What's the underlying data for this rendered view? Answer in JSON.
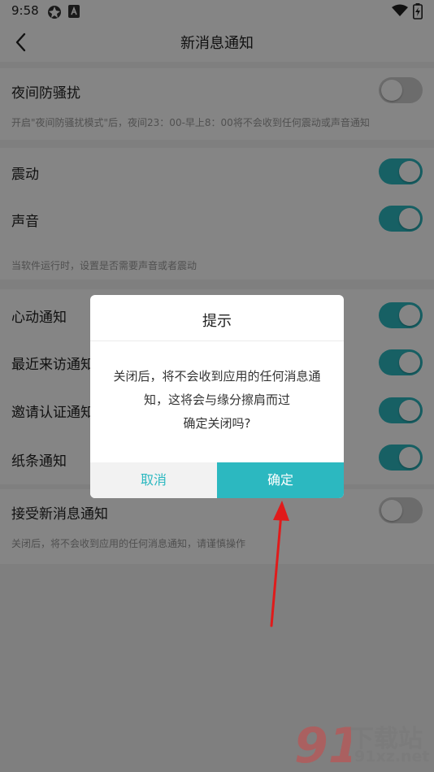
{
  "status_bar": {
    "time": "9:58",
    "icons": [
      "ball-icon",
      "app-a-icon",
      "wifi-icon",
      "battery-charging-icon"
    ]
  },
  "header": {
    "title": "新消息通知"
  },
  "settings": {
    "night_mode": {
      "label": "夜间防骚扰",
      "enabled": false,
      "hint": "开启\"夜间防骚扰模式\"后，夜间23：00-早上8：00将不会收到任何震动或声音通知"
    },
    "vibrate": {
      "label": "震动",
      "enabled": true
    },
    "sound": {
      "label": "声音",
      "enabled": true
    },
    "vibrate_sound_hint": "当软件运行时，设置是否需要声音或者震动",
    "heartbeat": {
      "label": "心动通知",
      "enabled": true
    },
    "recent_visitors": {
      "label": "最近来访通知",
      "enabled": true
    },
    "invite_verify": {
      "label": "邀请认证通知",
      "enabled": true
    },
    "note": {
      "label": "纸条通知",
      "enabled": true
    },
    "receive_new": {
      "label": "接受新消息通知",
      "enabled": false,
      "hint": "关闭后，将不会收到应用的任何消息通知，请谨慎操作"
    }
  },
  "dialog": {
    "title": "提示",
    "message_lines": [
      "关闭后，将不会收到应用的任何消息通",
      "知，这将会与缘分擦肩而过",
      "确定关闭吗?"
    ],
    "cancel_label": "取消",
    "confirm_label": "确定"
  },
  "watermark": {
    "logo_text": "91",
    "site_name": "下载站",
    "site_url": "91xz.net"
  },
  "colors": {
    "accent": "#2cb8c0",
    "switch_off": "#cfcfcf",
    "annotation_arrow": "#e01b1b"
  }
}
